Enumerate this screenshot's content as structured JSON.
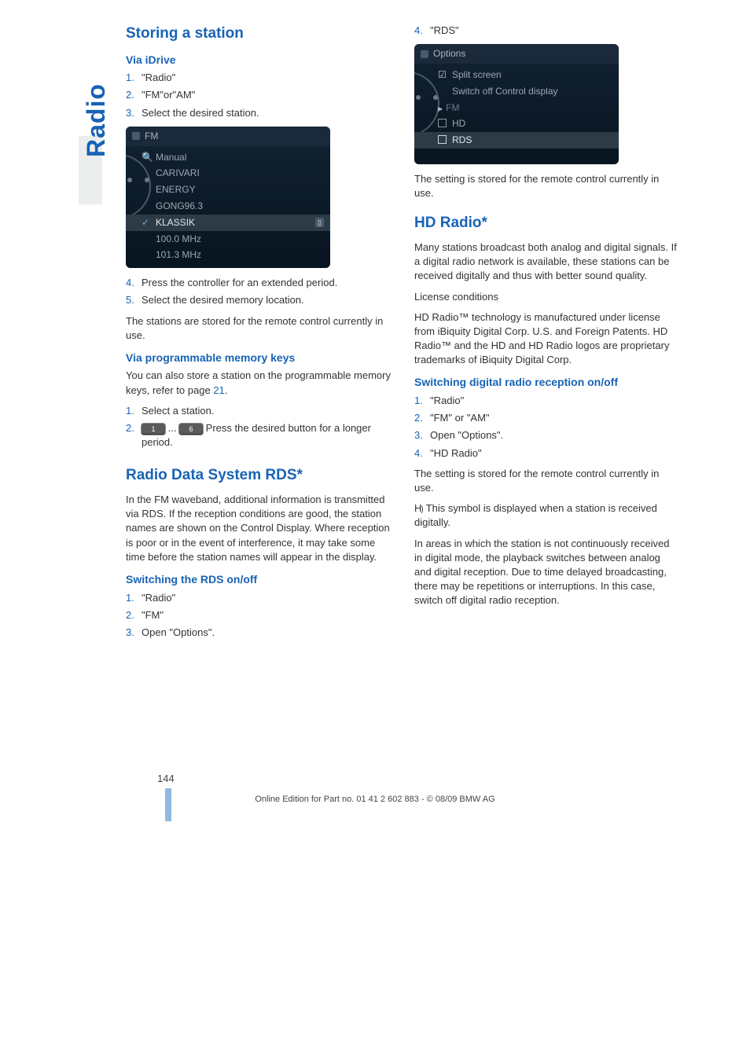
{
  "sideTab": "Radio",
  "left": {
    "h1_storing": "Storing a station",
    "h2_idrive": "Via iDrive",
    "idrive_steps_a": [
      "\"Radio\"",
      "\"FM\"or\"AM\"",
      "Select the desired station."
    ],
    "fig1": {
      "header_icon": "ant",
      "header_label": "FM",
      "rows": [
        {
          "icon": "mag",
          "label": "Manual"
        },
        {
          "label": "CARIVARI"
        },
        {
          "label": "ENERGY"
        },
        {
          "label": "GONG96.3"
        },
        {
          "icon": "tick",
          "label": "KLASSIK",
          "highlight": true,
          "right_icon": "sd"
        },
        {
          "label": "100.0 MHz"
        },
        {
          "label": "101.3 MHz"
        }
      ]
    },
    "idrive_steps_b": [
      "Press the controller for an extended period.",
      "Select the desired memory location."
    ],
    "idrive_after": "The stations are stored for the remote control currently in use.",
    "h2_prog": "Via programmable memory keys",
    "prog_intro_a": "You can also store a station on the programmable memory keys, refer to page ",
    "prog_intro_link": "21",
    "prog_intro_b": ".",
    "prog_steps": [
      "Select a station.",
      {
        "pre": "",
        "btn1": "1",
        "mid": " ... ",
        "btn2": "6",
        "post": " Press the desired button for a longer period."
      }
    ],
    "h1_rds": "Radio Data System RDS*",
    "rds_intro": "In the FM waveband, additional information is transmitted via RDS. If the reception conditions are good, the station names are shown on the Control Display. Where reception is poor or in the event of interference, it may take some time before the station names will appear in the display.",
    "h2_rds_switch": "Switching the RDS on/off",
    "rds_steps": [
      "\"Radio\"",
      "\"FM\"",
      "Open \"Options\"."
    ]
  },
  "right": {
    "step4": "\"RDS\"",
    "fig2": {
      "header_icon": "gear",
      "header_label": "Options",
      "rows": [
        {
          "icon": "check",
          "label": "Split screen"
        },
        {
          "label": "Switch off Control display"
        },
        {
          "label": "FM",
          "dim": true,
          "tri": true
        },
        {
          "icon": "checkbox",
          "label": "HD"
        },
        {
          "icon": "checkbox",
          "label": "RDS",
          "highlight": true
        }
      ]
    },
    "fig2_after": "The setting is stored for the remote control currently in use.",
    "h1_hd": "HD Radio*",
    "hd_p1": "Many stations broadcast both analog and digital signals. If a digital radio network is available, these stations can be received digitally and thus with better sound quality.",
    "hd_p2": "License conditions",
    "hd_p3": "HD Radio™ technology is manufactured under license from iBiquity Digital Corp. U.S. and Foreign Patents. HD Radio™ and the HD and HD Radio logos are proprietary trademarks of iBiquity Digital Corp.",
    "h2_hd_switch": "Switching digital radio reception on/off",
    "hd_steps": [
      "\"Radio\"",
      "\"FM\" or \"AM\"",
      "Open \"Options\".",
      "\"HD Radio\""
    ],
    "hd_after1": "The setting is stored for the remote control currently in use.",
    "hd_icon_text": "This symbol is displayed when a station is received digitally.",
    "hd_after2": "In areas in which the station is not continuously received in digital mode, the playback switches between analog and digital reception. Due to time delayed broadcasting, there may be repetitions or interruptions. In this case, switch off digital radio reception."
  },
  "pageNumber": "144",
  "footer": "Online Edition for Part no. 01 41 2 602 883 - © 08/09 BMW AG"
}
